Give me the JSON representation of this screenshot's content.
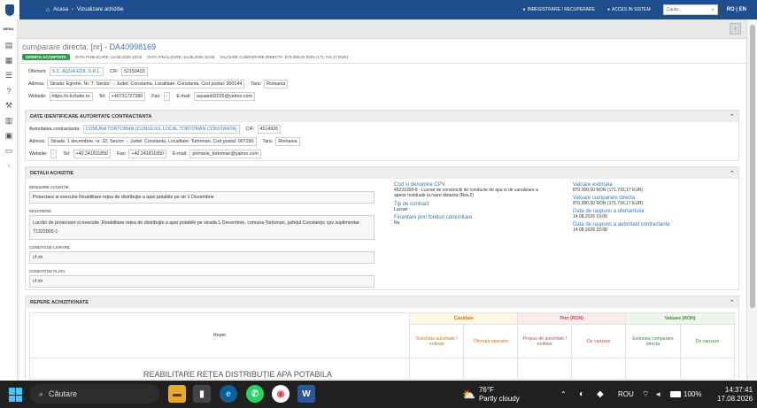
{
  "topbar": {
    "breadcrumb_home": "Acasa",
    "breadcrumb_current": "Vizualizare achizitie",
    "register_link": "INREGISTRARE / RECUPERARE",
    "access_link": "ACCES IN SISTEM",
    "search_placeholder": "Cauta...",
    "lang_ro": "RO",
    "lang_sep": "|",
    "lang_en": "EN"
  },
  "sidebar": {
    "menu_label": "MENU"
  },
  "procurement": {
    "title_prefix": "cumparare directa: [nr] -",
    "title_id": "DA40998169",
    "status_badge": "OFERTA ACCEPTATA",
    "data_publicare": "DATA PUBLICARE: 14.08.2026 15:02",
    "data_finalizare": "DATA FINALIZARE: 14.08.2026 15:08",
    "valoare": "VALOARE CUMPARARE DIRECTA: 870.000,00   RON (171.716,17   EUR)"
  },
  "ofertant": {
    "label": "Ofertant:",
    "name": "S.C. AQUA EDIL S.R.L.",
    "cif_label": "CIF:",
    "cif": "52159433",
    "adresa_label": "Adresa:",
    "adresa": "Strada: Egretei, Nr. 7, Sector: -, Judet: Constanta, Localitate: Constanta, Cod postal: 900144",
    "tara_label": "Tara:",
    "tara": "Romania",
    "website_label": "Website:",
    "website": "https://e-licitatie.ro",
    "tel_label": "Tel:",
    "tel": "+40731727380",
    "fax_label": "Fax:",
    "fax": "-",
    "email_label": "E-mail:",
    "email": "aquaedil2025@yahoo.com"
  },
  "autoritate": {
    "section_title": "DATE IDENTIFICARE AUTORITATE CONTRACTANTA",
    "label": "Autoritatea contractanta:",
    "name": "COMUNA TORTOMAN (CONSILIUL LOCAL TORTOMAN CONSTANTA)",
    "cif_label": "CIF:",
    "cif": "4514926",
    "adresa_label": "Adresa:",
    "adresa": "Strada: 1 decembrie, nr. 32, Sector: -, Judet: Constanta, Localitate: Tortoman, Cod postal: 907290",
    "tara_label": "Tara:",
    "tara": "Romania",
    "website_label": "Website:",
    "website": "-",
    "tel_label": "Tel:",
    "tel": "+40 241811850",
    "fax_label": "Fax:",
    "fax": "+40 241811850",
    "email_label": "E-mail:",
    "email": "primaria_tortoman@yahoo.com"
  },
  "detalii": {
    "section_title": "DETALII ACHIZITIE",
    "denumire_label": "DENUMIRE ACHIZITIE",
    "denumire": "Proiectare si executie Reabilitare reţea de distribuţie a apei potabile pe str 1 Decembrie",
    "descriere_label": "DESCRIERE",
    "descriere": "Lucrări de proiectare si executie ,Reabilitare reţea de distribuţie a apei potabile pe strada 1 Decembrie, comuna Tortoman, judeţul Constanţa; cpv suplimentar 71322000-1",
    "livrare_label": "CONDITII DE LIVRARE:",
    "livrare": "cf ctr",
    "plata_label": "CONDITII DE PLATA:",
    "plata": "cf ctr",
    "cpv_label": "Cod si denumire CPV",
    "cpv": "45231300-8 - Lucrari de constructii de conducte de apa si de canalizare a apelor reziduale la mare distanta (Rev.2)",
    "tip_label": "Tip de contract",
    "tip": "Lucrari",
    "fonduri_label": "Finantare prin fonduri comunitare",
    "fonduri": "Nu",
    "val_est_label": "Valoare estimata",
    "val_est": "870.000,00   RON (171.716,17   EUR)",
    "val_cump_label": "Valoare cumparare directa",
    "val_cump": "870.000,00   RON (171.716,17   EUR)",
    "raspuns_of_label": "Data de raspuns a ofertantului",
    "raspuns_of": "14.08.2026 15:05",
    "raspuns_aut_label": "Data de raspuns a autoritatii contractante",
    "raspuns_aut": "14.08.2026 15:08"
  },
  "repere": {
    "section_title": "REPERE ACHIZITIONATE",
    "col_reper": "Reper",
    "group_cantitate": "Cantitate",
    "group_pret": "Pret (RON)",
    "group_valoare": "Valoare (RON)",
    "sub_solicitata": "Solicitata autoritate / entitate",
    "sub_oferta": "Ofertata operator",
    "sub_propus": "Propus de autoritate / entitate",
    "sub_vanzare_pret": "De vanzare",
    "sub_estimata": "Estimata cumparare directa",
    "sub_vanzare_val": "De vanzare",
    "row1_name": "REABILITARE REȚEA DISTRIBUȚIE APA POTABILA"
  },
  "taskbar": {
    "search_text": "Căutare",
    "temperature": "76°F",
    "weather": "Partly cloudy",
    "lang": "ROU",
    "battery": "100%",
    "time": "14:37:41",
    "date": "17.08.2026"
  },
  "colors": {
    "topbar": "#1f4e8c",
    "badge": "#2e9e4f",
    "link": "#3777bb"
  }
}
